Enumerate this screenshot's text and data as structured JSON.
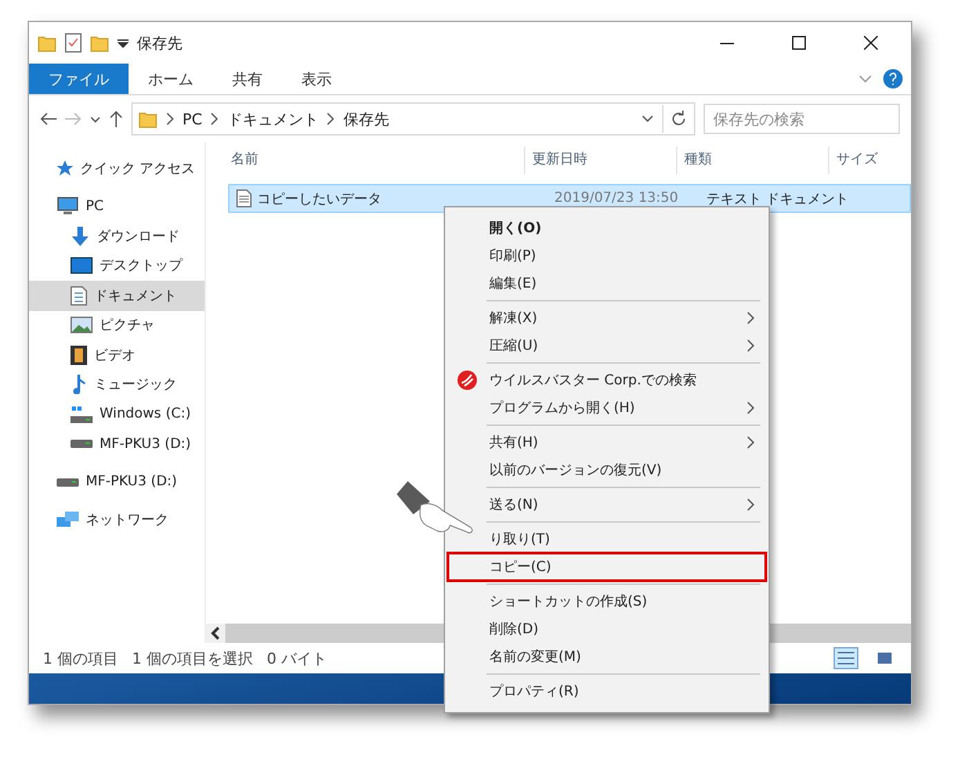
{
  "window": {
    "title": "保存先"
  },
  "ribbon_tabs": [
    {
      "label": "ファイル",
      "selected": true
    },
    {
      "label": "ホーム",
      "selected": false
    },
    {
      "label": "共有",
      "selected": false
    },
    {
      "label": "表示",
      "selected": false
    }
  ],
  "address": {
    "crumbs": [
      "PC",
      "ドキュメント",
      "保存先"
    ]
  },
  "search": {
    "placeholder": "保存先の検索"
  },
  "sidebar": {
    "items": [
      {
        "kind": "star",
        "label": "クイック アクセス",
        "selected": false
      },
      {
        "kind": "pc",
        "label": "PC",
        "selected": false,
        "children": [
          {
            "kind": "download",
            "label": "ダウンロード",
            "selected": false
          },
          {
            "kind": "desktop",
            "label": "デスクトップ",
            "selected": false
          },
          {
            "kind": "documents",
            "label": "ドキュメント",
            "selected": true
          },
          {
            "kind": "pictures",
            "label": "ピクチャ",
            "selected": false
          },
          {
            "kind": "videos",
            "label": "ビデオ",
            "selected": false
          },
          {
            "kind": "music",
            "label": "ミュージック",
            "selected": false
          },
          {
            "kind": "windows",
            "label": "Windows (C:)",
            "selected": false
          },
          {
            "kind": "drive",
            "label": "MF-PKU3 (D:)",
            "selected": false
          }
        ]
      },
      {
        "kind": "drive",
        "label": "MF-PKU3 (D:)",
        "selected": false
      },
      {
        "kind": "network",
        "label": "ネットワーク",
        "selected": false
      }
    ]
  },
  "table": {
    "columns": [
      "名前",
      "更新日時",
      "種類",
      "サイズ"
    ],
    "rows": [
      {
        "name": "コピーしたいデータ",
        "modified": "2019/07/23 13:50",
        "type": "テキスト ドキュメント",
        "selected": true
      }
    ]
  },
  "context_menu": {
    "items": [
      {
        "kind": "item",
        "label": "開く(O)",
        "bold": true,
        "submenu": false,
        "selected": false
      },
      {
        "kind": "item",
        "label": "印刷(P)",
        "bold": false,
        "submenu": false,
        "selected": false
      },
      {
        "kind": "item",
        "label": "編集(E)",
        "bold": false,
        "submenu": false,
        "selected": false
      },
      {
        "kind": "separator"
      },
      {
        "kind": "item",
        "label": "解凍(X)",
        "bold": false,
        "submenu": true,
        "selected": false
      },
      {
        "kind": "item",
        "label": "圧縮(U)",
        "bold": false,
        "submenu": true,
        "selected": false
      },
      {
        "kind": "separator"
      },
      {
        "kind": "app",
        "label": "ウイルスバスター Corp.での検索",
        "bold": false,
        "submenu": false,
        "selected": false
      },
      {
        "kind": "item",
        "label": "プログラムから開く(H)",
        "bold": false,
        "submenu": true,
        "selected": false
      },
      {
        "kind": "separator"
      },
      {
        "kind": "item",
        "label": "共有(H)",
        "bold": false,
        "submenu": true,
        "selected": false
      },
      {
        "kind": "item",
        "label": "以前のバージョンの復元(V)",
        "bold": false,
        "submenu": false,
        "selected": false
      },
      {
        "kind": "separator"
      },
      {
        "kind": "item",
        "label": "送る(N)",
        "bold": false,
        "submenu": true,
        "selected": false
      },
      {
        "kind": "separator"
      },
      {
        "kind": "item",
        "label": "り取り(T)",
        "bold": false,
        "submenu": false,
        "selected": false
      },
      {
        "kind": "item",
        "label": "コピー(C)",
        "bold": false,
        "submenu": false,
        "selected": true
      },
      {
        "kind": "separator"
      },
      {
        "kind": "item",
        "label": "ショートカットの作成(S)",
        "bold": false,
        "submenu": false,
        "selected": false
      },
      {
        "kind": "item",
        "label": "削除(D)",
        "bold": false,
        "submenu": false,
        "selected": false
      },
      {
        "kind": "item",
        "label": "名前の変更(M)",
        "bold": false,
        "submenu": false,
        "selected": false
      },
      {
        "kind": "separator"
      },
      {
        "kind": "item",
        "label": "プロパティ(R)",
        "bold": false,
        "submenu": false,
        "selected": false
      }
    ]
  },
  "status_bar": {
    "items": [
      "1 個の項目",
      "1 個の項目を選択",
      "0 バイト"
    ],
    "views": [
      {
        "kind": "details",
        "selected": true
      },
      {
        "kind": "icons",
        "selected": false
      }
    ]
  }
}
